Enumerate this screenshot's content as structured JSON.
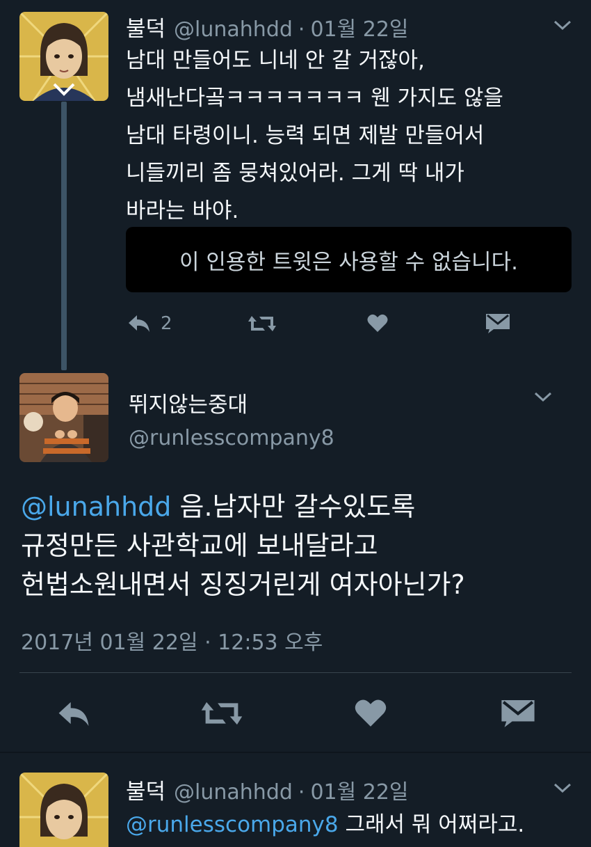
{
  "tweet1": {
    "name": "불덕",
    "handle": "@lunahhdd",
    "sep": "·",
    "date": "01월 22일",
    "lines": [
      "남대 만들어도 니네 안 갈 거잖아,",
      "냄새난다곸ㅋㅋㅋㅋㅋㅋㅋ 웬 가지도 않을",
      "남대 타령이니. 능력 되면 제발 만들어서",
      "니들끼리 좀 뭉쳐있어라. 그게 딱 내가",
      "바라는 바야."
    ],
    "quote_unavailable": "이 인용한 트윗은 사용할 수 없습니다.",
    "reply_count": "2",
    "icons": [
      "reply-icon",
      "retweet-icon",
      "like-icon",
      "dm-icon",
      "chevron-down-icon"
    ]
  },
  "tweet2": {
    "name": "뛰지않는중대",
    "handle": "@runlesscompany8",
    "mention": "@lunahhdd",
    "line1_rest": " 음.남자만 갈수있도록",
    "line2": "규정만든 사관학교에 보내달라고",
    "line3": "헌법소원내면서 징징거린게 여자아닌가?",
    "timestamp": "2017년 01월 22일 · 12:53 오후",
    "icons": [
      "reply-icon",
      "retweet-icon",
      "like-icon",
      "dm-icon",
      "chevron-down-icon"
    ]
  },
  "tweet3": {
    "name": "불덕",
    "handle": "@lunahhdd",
    "sep": "·",
    "date": "01월 22일",
    "mention": "@runlesscompany8",
    "rest": " 그래서 뭐 어쩌라고."
  },
  "colors": {
    "background": "#141d26",
    "text": "#f5f8fa",
    "secondary": "#8899a6",
    "mention": "#4aa8ea",
    "thread_line": "#3d5466",
    "quote_box": "#000000"
  }
}
